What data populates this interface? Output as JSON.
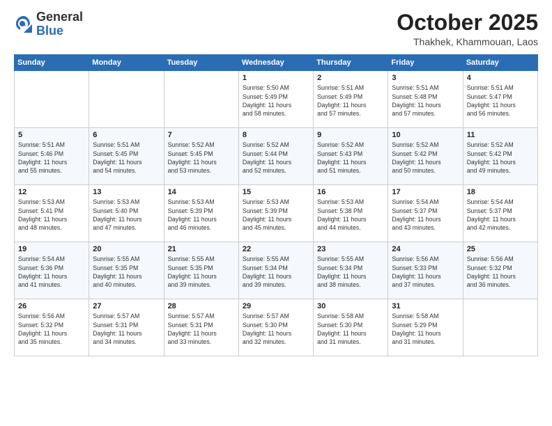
{
  "header": {
    "logo_general": "General",
    "logo_blue": "Blue",
    "month": "October 2025",
    "location": "Thakhek, Khammouan, Laos"
  },
  "days_of_week": [
    "Sunday",
    "Monday",
    "Tuesday",
    "Wednesday",
    "Thursday",
    "Friday",
    "Saturday"
  ],
  "weeks": [
    [
      {
        "day": "",
        "info": ""
      },
      {
        "day": "",
        "info": ""
      },
      {
        "day": "",
        "info": ""
      },
      {
        "day": "1",
        "info": "Sunrise: 5:50 AM\nSunset: 5:49 PM\nDaylight: 11 hours\nand 58 minutes."
      },
      {
        "day": "2",
        "info": "Sunrise: 5:51 AM\nSunset: 5:49 PM\nDaylight: 11 hours\nand 57 minutes."
      },
      {
        "day": "3",
        "info": "Sunrise: 5:51 AM\nSunset: 5:48 PM\nDaylight: 11 hours\nand 57 minutes."
      },
      {
        "day": "4",
        "info": "Sunrise: 5:51 AM\nSunset: 5:47 PM\nDaylight: 11 hours\nand 56 minutes."
      }
    ],
    [
      {
        "day": "5",
        "info": "Sunrise: 5:51 AM\nSunset: 5:46 PM\nDaylight: 11 hours\nand 55 minutes."
      },
      {
        "day": "6",
        "info": "Sunrise: 5:51 AM\nSunset: 5:45 PM\nDaylight: 11 hours\nand 54 minutes."
      },
      {
        "day": "7",
        "info": "Sunrise: 5:52 AM\nSunset: 5:45 PM\nDaylight: 11 hours\nand 53 minutes."
      },
      {
        "day": "8",
        "info": "Sunrise: 5:52 AM\nSunset: 5:44 PM\nDaylight: 11 hours\nand 52 minutes."
      },
      {
        "day": "9",
        "info": "Sunrise: 5:52 AM\nSunset: 5:43 PM\nDaylight: 11 hours\nand 51 minutes."
      },
      {
        "day": "10",
        "info": "Sunrise: 5:52 AM\nSunset: 5:42 PM\nDaylight: 11 hours\nand 50 minutes."
      },
      {
        "day": "11",
        "info": "Sunrise: 5:52 AM\nSunset: 5:42 PM\nDaylight: 11 hours\nand 49 minutes."
      }
    ],
    [
      {
        "day": "12",
        "info": "Sunrise: 5:53 AM\nSunset: 5:41 PM\nDaylight: 11 hours\nand 48 minutes."
      },
      {
        "day": "13",
        "info": "Sunrise: 5:53 AM\nSunset: 5:40 PM\nDaylight: 11 hours\nand 47 minutes."
      },
      {
        "day": "14",
        "info": "Sunrise: 5:53 AM\nSunset: 5:39 PM\nDaylight: 11 hours\nand 46 minutes."
      },
      {
        "day": "15",
        "info": "Sunrise: 5:53 AM\nSunset: 5:39 PM\nDaylight: 11 hours\nand 45 minutes."
      },
      {
        "day": "16",
        "info": "Sunrise: 5:53 AM\nSunset: 5:38 PM\nDaylight: 11 hours\nand 44 minutes."
      },
      {
        "day": "17",
        "info": "Sunrise: 5:54 AM\nSunset: 5:37 PM\nDaylight: 11 hours\nand 43 minutes."
      },
      {
        "day": "18",
        "info": "Sunrise: 5:54 AM\nSunset: 5:37 PM\nDaylight: 11 hours\nand 42 minutes."
      }
    ],
    [
      {
        "day": "19",
        "info": "Sunrise: 5:54 AM\nSunset: 5:36 PM\nDaylight: 11 hours\nand 41 minutes."
      },
      {
        "day": "20",
        "info": "Sunrise: 5:55 AM\nSunset: 5:35 PM\nDaylight: 11 hours\nand 40 minutes."
      },
      {
        "day": "21",
        "info": "Sunrise: 5:55 AM\nSunset: 5:35 PM\nDaylight: 11 hours\nand 39 minutes."
      },
      {
        "day": "22",
        "info": "Sunrise: 5:55 AM\nSunset: 5:34 PM\nDaylight: 11 hours\nand 39 minutes."
      },
      {
        "day": "23",
        "info": "Sunrise: 5:55 AM\nSunset: 5:34 PM\nDaylight: 11 hours\nand 38 minutes."
      },
      {
        "day": "24",
        "info": "Sunrise: 5:56 AM\nSunset: 5:33 PM\nDaylight: 11 hours\nand 37 minutes."
      },
      {
        "day": "25",
        "info": "Sunrise: 5:56 AM\nSunset: 5:32 PM\nDaylight: 11 hours\nand 36 minutes."
      }
    ],
    [
      {
        "day": "26",
        "info": "Sunrise: 5:56 AM\nSunset: 5:32 PM\nDaylight: 11 hours\nand 35 minutes."
      },
      {
        "day": "27",
        "info": "Sunrise: 5:57 AM\nSunset: 5:31 PM\nDaylight: 11 hours\nand 34 minutes."
      },
      {
        "day": "28",
        "info": "Sunrise: 5:57 AM\nSunset: 5:31 PM\nDaylight: 11 hours\nand 33 minutes."
      },
      {
        "day": "29",
        "info": "Sunrise: 5:57 AM\nSunset: 5:30 PM\nDaylight: 11 hours\nand 32 minutes."
      },
      {
        "day": "30",
        "info": "Sunrise: 5:58 AM\nSunset: 5:30 PM\nDaylight: 11 hours\nand 31 minutes."
      },
      {
        "day": "31",
        "info": "Sunrise: 5:58 AM\nSunset: 5:29 PM\nDaylight: 11 hours\nand 31 minutes."
      },
      {
        "day": "",
        "info": ""
      }
    ]
  ]
}
